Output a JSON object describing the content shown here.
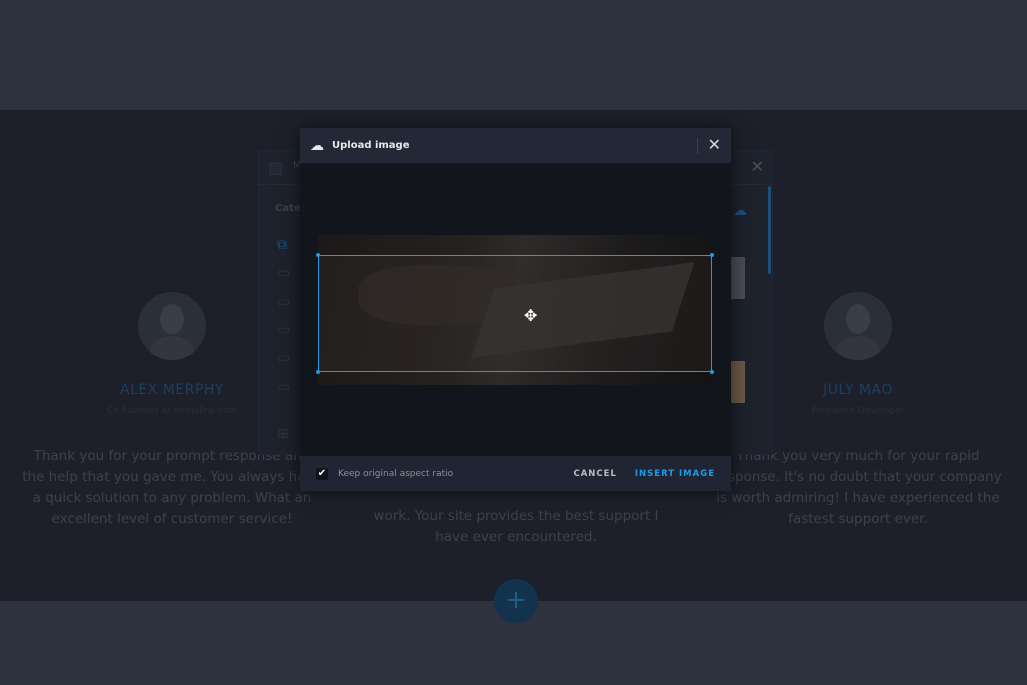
{
  "testimonials": [
    {
      "name": "ALEX MERPHY",
      "role": "Co-Founder at demolink.com",
      "text": "Thank you for your prompt response and the help that you gave me. You always have a quick solution to any problem. What an excellent level of customer service!"
    },
    {
      "text": "work. Your site provides the best support I have ever encountered."
    },
    {
      "name": "JULY MAO",
      "role": "Freelance Developer",
      "text": "Thank you very much for your rapid response. It's no doubt that your company is worth admiring! I have experienced the fastest support ever."
    }
  ],
  "media_library": {
    "title": "M",
    "category_label": "Categ"
  },
  "upload_dialog": {
    "title": "Upload image",
    "keep_ratio_label": "Keep original aspect ratio",
    "keep_ratio_checked": true,
    "cancel_label": "CANCEL",
    "insert_label": "INSERT IMAGE"
  },
  "add_button": "+",
  "colors": {
    "accent": "#1e9be6"
  }
}
